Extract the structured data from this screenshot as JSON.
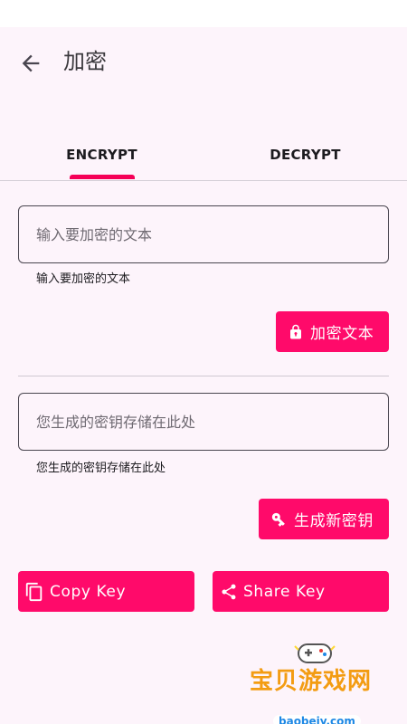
{
  "colors": {
    "accent": "#ff0a6a",
    "background": "#fdf4fb",
    "outline": "#49454f"
  },
  "appbar": {
    "title": "加密",
    "back_icon": "arrow-back-icon"
  },
  "tabs": [
    {
      "label": "ENCRYPT",
      "selected": true
    },
    {
      "label": "DECRYPT",
      "selected": false
    }
  ],
  "encrypt": {
    "text_input": {
      "placeholder": "输入要加密的文本",
      "value": ""
    },
    "helper": "输入要加密的文本",
    "encrypt_button": {
      "label": "加密文本",
      "icon": "lock-icon"
    }
  },
  "key": {
    "key_input": {
      "placeholder": "您生成的密钥存储在此处",
      "value": ""
    },
    "helper": "您生成的密钥存储在此处",
    "generate_button": {
      "label": "生成新密钥",
      "icon": "key-icon"
    },
    "copy_button": {
      "label": "Copy Key",
      "icon": "copy-icon"
    },
    "share_button": {
      "label": "Share Key",
      "icon": "share-icon"
    }
  },
  "watermark": {
    "text": "宝贝游戏网",
    "sub": "baobeiy.com",
    "icon": "gamepad-logo-icon"
  }
}
